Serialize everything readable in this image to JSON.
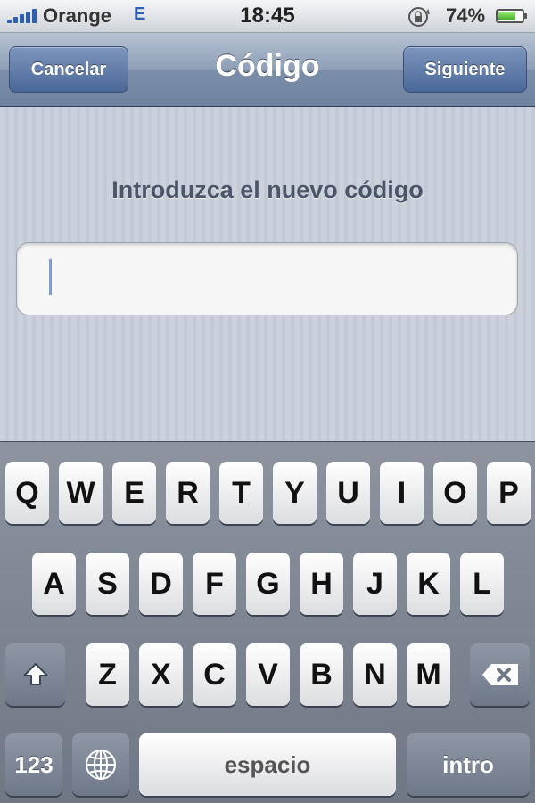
{
  "status_bar": {
    "carrier": "Orange",
    "network": "E",
    "time": "18:45",
    "battery_percent": "74%",
    "battery_level": 0.74,
    "icons": [
      "signal-bars-icon",
      "rotation-lock-icon",
      "battery-icon"
    ]
  },
  "navbar": {
    "cancel_label": "Cancelar",
    "title": "Código",
    "next_label": "Siguiente"
  },
  "content": {
    "prompt": "Introduzca el nuevo código",
    "passcode_value": ""
  },
  "keyboard": {
    "row1": [
      "Q",
      "W",
      "E",
      "R",
      "T",
      "Y",
      "U",
      "I",
      "O",
      "P"
    ],
    "row2": [
      "A",
      "S",
      "D",
      "F",
      "G",
      "H",
      "J",
      "K",
      "L"
    ],
    "row3": [
      "Z",
      "X",
      "C",
      "V",
      "B",
      "N",
      "M"
    ],
    "numbers_label": "123",
    "space_label": "espacio",
    "return_label": "intro",
    "icons": [
      "shift-icon",
      "backspace-icon",
      "globe-icon"
    ]
  },
  "colors": {
    "accent_blue": "#2d5fb4",
    "nav_button": "#4a6897",
    "prompt_text": "#4c566a"
  }
}
